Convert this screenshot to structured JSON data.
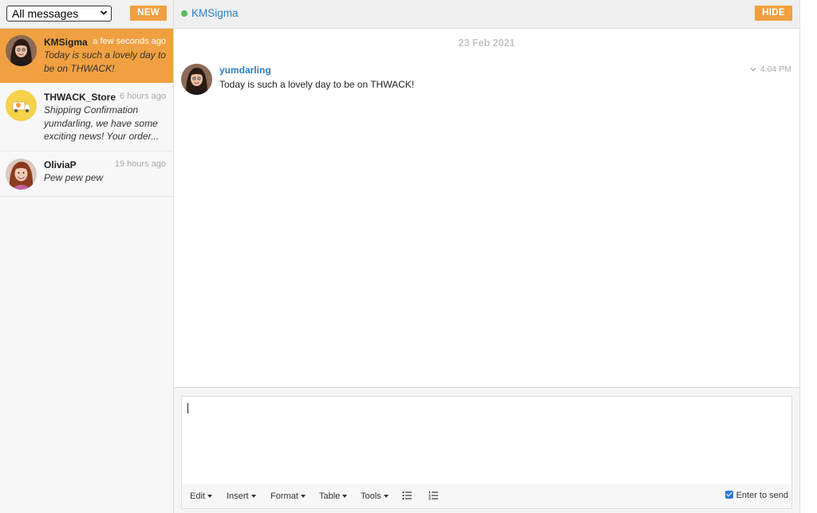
{
  "sidebar": {
    "filter": {
      "selected": "All messages"
    },
    "new_label": "NEW",
    "conversations": [
      {
        "name": "KMSigma",
        "time": "a few seconds ago",
        "preview": "Today is such a lovely day to be on THWACK!",
        "active": true,
        "avatar": "woman-dark-hair-avatar"
      },
      {
        "name": "THWACK_Store",
        "time": "6 hours ago",
        "preview": "Shipping Confirmation yumdarling, we have some exciting news! Your order...",
        "active": false,
        "avatar": "delivery-truck-avatar"
      },
      {
        "name": "OliviaP",
        "time": "19 hours ago",
        "preview": "Pew pew pew",
        "active": false,
        "avatar": "woman-red-hair-avatar"
      }
    ]
  },
  "header": {
    "contact_name": "KMSigma",
    "hide_label": "HIDE",
    "status_color": "#5cb85c"
  },
  "chat": {
    "date": "23 Feb 2021",
    "messages": [
      {
        "author": "yumdarling",
        "text": "Today is such a lovely day to be on THWACK!",
        "time": "4:04 PM"
      }
    ]
  },
  "composer": {
    "toolbar": {
      "edit": "Edit",
      "insert": "Insert",
      "format": "Format",
      "table": "Table",
      "tools": "Tools"
    },
    "enter_to_send_label": "Enter to send",
    "enter_to_send_checked": true
  },
  "colors": {
    "accent": "#f0a040",
    "link": "#2d7fbf"
  }
}
